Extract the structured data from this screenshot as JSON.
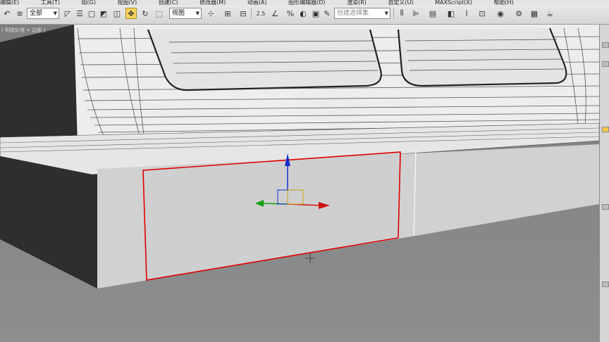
{
  "menu": [
    "编辑(E)",
    "工具(T)",
    "组(G)",
    "视图(V)",
    "创建(C)",
    "修改器(M)",
    "动画(A)",
    "图形编辑器(D)",
    "渲染(R)",
    "自定义(U)",
    "MAXScript(X)",
    "帮助(H)"
  ],
  "toolbar": {
    "filter_value": "全部",
    "coord_value": "视图",
    "named_selection_placeholder": "创建选择集",
    "snap_angle_label": "2.5",
    "percent_snap_label": "%"
  },
  "viewport": {
    "label": "[ 明暗处理 + 边面 ]",
    "selected_edge_color": "#e00000",
    "gizmo_colors": {
      "x": "#d01010",
      "y": "#10a010",
      "z": "#1030d0"
    }
  }
}
